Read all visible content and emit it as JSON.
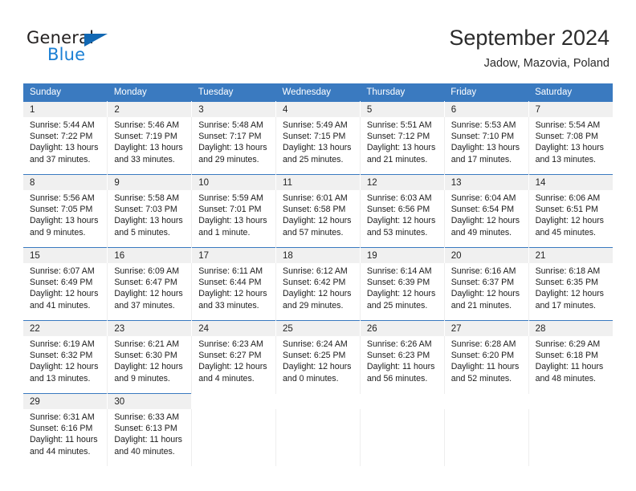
{
  "brand": {
    "name_dark": "General",
    "name_blue": "Blue",
    "triangle_color": "#1268b3",
    "blue_color": "#1a7fd4"
  },
  "header": {
    "title": "September 2024",
    "subtitle": "Jadow, Mazovia, Poland"
  },
  "theme": {
    "header_bg": "#3a7ac0",
    "header_text": "#ffffff",
    "daynum_bg": "#f0f0f0",
    "rule_color": "#3a7ac0"
  },
  "weekday_headers": [
    "Sunday",
    "Monday",
    "Tuesday",
    "Wednesday",
    "Thursday",
    "Friday",
    "Saturday"
  ],
  "weeks": [
    {
      "days": [
        {
          "num": "1",
          "sunrise": "Sunrise: 5:44 AM",
          "sunset": "Sunset: 7:22 PM",
          "daylight1": "Daylight: 13 hours",
          "daylight2": "and 37 minutes."
        },
        {
          "num": "2",
          "sunrise": "Sunrise: 5:46 AM",
          "sunset": "Sunset: 7:19 PM",
          "daylight1": "Daylight: 13 hours",
          "daylight2": "and 33 minutes."
        },
        {
          "num": "3",
          "sunrise": "Sunrise: 5:48 AM",
          "sunset": "Sunset: 7:17 PM",
          "daylight1": "Daylight: 13 hours",
          "daylight2": "and 29 minutes."
        },
        {
          "num": "4",
          "sunrise": "Sunrise: 5:49 AM",
          "sunset": "Sunset: 7:15 PM",
          "daylight1": "Daylight: 13 hours",
          "daylight2": "and 25 minutes."
        },
        {
          "num": "5",
          "sunrise": "Sunrise: 5:51 AM",
          "sunset": "Sunset: 7:12 PM",
          "daylight1": "Daylight: 13 hours",
          "daylight2": "and 21 minutes."
        },
        {
          "num": "6",
          "sunrise": "Sunrise: 5:53 AM",
          "sunset": "Sunset: 7:10 PM",
          "daylight1": "Daylight: 13 hours",
          "daylight2": "and 17 minutes."
        },
        {
          "num": "7",
          "sunrise": "Sunrise: 5:54 AM",
          "sunset": "Sunset: 7:08 PM",
          "daylight1": "Daylight: 13 hours",
          "daylight2": "and 13 minutes."
        }
      ]
    },
    {
      "days": [
        {
          "num": "8",
          "sunrise": "Sunrise: 5:56 AM",
          "sunset": "Sunset: 7:05 PM",
          "daylight1": "Daylight: 13 hours",
          "daylight2": "and 9 minutes."
        },
        {
          "num": "9",
          "sunrise": "Sunrise: 5:58 AM",
          "sunset": "Sunset: 7:03 PM",
          "daylight1": "Daylight: 13 hours",
          "daylight2": "and 5 minutes."
        },
        {
          "num": "10",
          "sunrise": "Sunrise: 5:59 AM",
          "sunset": "Sunset: 7:01 PM",
          "daylight1": "Daylight: 13 hours",
          "daylight2": "and 1 minute."
        },
        {
          "num": "11",
          "sunrise": "Sunrise: 6:01 AM",
          "sunset": "Sunset: 6:58 PM",
          "daylight1": "Daylight: 12 hours",
          "daylight2": "and 57 minutes."
        },
        {
          "num": "12",
          "sunrise": "Sunrise: 6:03 AM",
          "sunset": "Sunset: 6:56 PM",
          "daylight1": "Daylight: 12 hours",
          "daylight2": "and 53 minutes."
        },
        {
          "num": "13",
          "sunrise": "Sunrise: 6:04 AM",
          "sunset": "Sunset: 6:54 PM",
          "daylight1": "Daylight: 12 hours",
          "daylight2": "and 49 minutes."
        },
        {
          "num": "14",
          "sunrise": "Sunrise: 6:06 AM",
          "sunset": "Sunset: 6:51 PM",
          "daylight1": "Daylight: 12 hours",
          "daylight2": "and 45 minutes."
        }
      ]
    },
    {
      "days": [
        {
          "num": "15",
          "sunrise": "Sunrise: 6:07 AM",
          "sunset": "Sunset: 6:49 PM",
          "daylight1": "Daylight: 12 hours",
          "daylight2": "and 41 minutes."
        },
        {
          "num": "16",
          "sunrise": "Sunrise: 6:09 AM",
          "sunset": "Sunset: 6:47 PM",
          "daylight1": "Daylight: 12 hours",
          "daylight2": "and 37 minutes."
        },
        {
          "num": "17",
          "sunrise": "Sunrise: 6:11 AM",
          "sunset": "Sunset: 6:44 PM",
          "daylight1": "Daylight: 12 hours",
          "daylight2": "and 33 minutes."
        },
        {
          "num": "18",
          "sunrise": "Sunrise: 6:12 AM",
          "sunset": "Sunset: 6:42 PM",
          "daylight1": "Daylight: 12 hours",
          "daylight2": "and 29 minutes."
        },
        {
          "num": "19",
          "sunrise": "Sunrise: 6:14 AM",
          "sunset": "Sunset: 6:39 PM",
          "daylight1": "Daylight: 12 hours",
          "daylight2": "and 25 minutes."
        },
        {
          "num": "20",
          "sunrise": "Sunrise: 6:16 AM",
          "sunset": "Sunset: 6:37 PM",
          "daylight1": "Daylight: 12 hours",
          "daylight2": "and 21 minutes."
        },
        {
          "num": "21",
          "sunrise": "Sunrise: 6:18 AM",
          "sunset": "Sunset: 6:35 PM",
          "daylight1": "Daylight: 12 hours",
          "daylight2": "and 17 minutes."
        }
      ]
    },
    {
      "days": [
        {
          "num": "22",
          "sunrise": "Sunrise: 6:19 AM",
          "sunset": "Sunset: 6:32 PM",
          "daylight1": "Daylight: 12 hours",
          "daylight2": "and 13 minutes."
        },
        {
          "num": "23",
          "sunrise": "Sunrise: 6:21 AM",
          "sunset": "Sunset: 6:30 PM",
          "daylight1": "Daylight: 12 hours",
          "daylight2": "and 9 minutes."
        },
        {
          "num": "24",
          "sunrise": "Sunrise: 6:23 AM",
          "sunset": "Sunset: 6:27 PM",
          "daylight1": "Daylight: 12 hours",
          "daylight2": "and 4 minutes."
        },
        {
          "num": "25",
          "sunrise": "Sunrise: 6:24 AM",
          "sunset": "Sunset: 6:25 PM",
          "daylight1": "Daylight: 12 hours",
          "daylight2": "and 0 minutes."
        },
        {
          "num": "26",
          "sunrise": "Sunrise: 6:26 AM",
          "sunset": "Sunset: 6:23 PM",
          "daylight1": "Daylight: 11 hours",
          "daylight2": "and 56 minutes."
        },
        {
          "num": "27",
          "sunrise": "Sunrise: 6:28 AM",
          "sunset": "Sunset: 6:20 PM",
          "daylight1": "Daylight: 11 hours",
          "daylight2": "and 52 minutes."
        },
        {
          "num": "28",
          "sunrise": "Sunrise: 6:29 AM",
          "sunset": "Sunset: 6:18 PM",
          "daylight1": "Daylight: 11 hours",
          "daylight2": "and 48 minutes."
        }
      ]
    },
    {
      "days": [
        {
          "num": "29",
          "sunrise": "Sunrise: 6:31 AM",
          "sunset": "Sunset: 6:16 PM",
          "daylight1": "Daylight: 11 hours",
          "daylight2": "and 44 minutes."
        },
        {
          "num": "30",
          "sunrise": "Sunrise: 6:33 AM",
          "sunset": "Sunset: 6:13 PM",
          "daylight1": "Daylight: 11 hours",
          "daylight2": "and 40 minutes."
        },
        {
          "num": "",
          "sunrise": "",
          "sunset": "",
          "daylight1": "",
          "daylight2": ""
        },
        {
          "num": "",
          "sunrise": "",
          "sunset": "",
          "daylight1": "",
          "daylight2": ""
        },
        {
          "num": "",
          "sunrise": "",
          "sunset": "",
          "daylight1": "",
          "daylight2": ""
        },
        {
          "num": "",
          "sunrise": "",
          "sunset": "",
          "daylight1": "",
          "daylight2": ""
        },
        {
          "num": "",
          "sunrise": "",
          "sunset": "",
          "daylight1": "",
          "daylight2": ""
        }
      ]
    }
  ]
}
